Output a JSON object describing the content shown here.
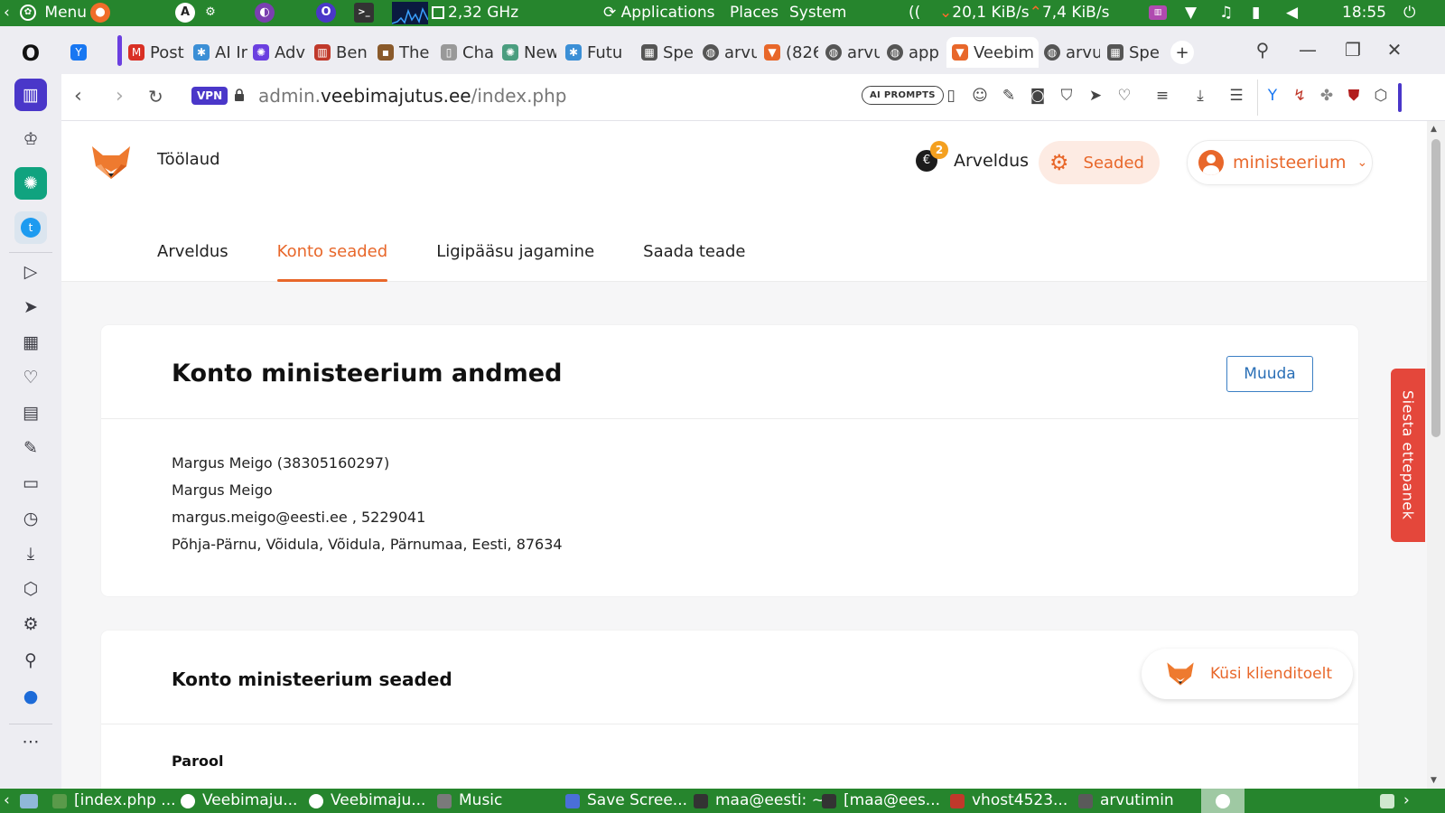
{
  "system_top": {
    "menu_label": "Menu",
    "cpu_freq": "2,32 GHz",
    "applications": "Applications",
    "places": "Places",
    "system": "System",
    "net_down": "20,1 KiB/s",
    "net_up": "7,4 KiB/s",
    "clock": "18:55"
  },
  "tabs": [
    {
      "label": "Post",
      "icon": "gmail-icon",
      "color": "#d93025"
    },
    {
      "label": "AI Ir",
      "icon": "ai-icon",
      "color": "#3b8fd6"
    },
    {
      "label": "Adv",
      "icon": "chatgpt-icon",
      "color": "#6b3fe0"
    },
    {
      "label": "Ben",
      "icon": "grid-icon",
      "color": "#c0392b"
    },
    {
      "label": "The",
      "icon": "photo-icon",
      "color": "#8a5a2b"
    },
    {
      "label": "Cha",
      "icon": "book-icon",
      "color": "#777777"
    },
    {
      "label": "New",
      "icon": "chatgpt-icon",
      "color": "#4a9d7f"
    },
    {
      "label": "Futu",
      "icon": "ai-icon",
      "color": "#3b8fd6"
    },
    {
      "label": "Spe",
      "icon": "grid-icon",
      "color": "#555555"
    },
    {
      "label": "arvu",
      "icon": "globe-icon",
      "color": "#555555"
    },
    {
      "label": "(826",
      "icon": "fox-icon",
      "color": "#e8672a"
    },
    {
      "label": "arvu",
      "icon": "globe-icon",
      "color": "#555555"
    },
    {
      "label": "app",
      "icon": "globe-icon",
      "color": "#555555"
    },
    {
      "label": "Veebim",
      "icon": "fox-icon",
      "color": "#e8672a"
    },
    {
      "label": "arvu",
      "icon": "globe-icon",
      "color": "#555555"
    },
    {
      "label": "Spe",
      "icon": "grid-icon",
      "color": "#555555"
    }
  ],
  "address": {
    "vpn": "VPN",
    "url_prefix": "admin.",
    "url_domain": "veebimajutus.ee",
    "url_path": "/index.php",
    "ai_prompts": "AI PROMPTS"
  },
  "header": {
    "title": "Töölaud",
    "billing_label": "Arveldus",
    "billing_badge": "2",
    "settings_label": "Seaded",
    "user_label": "ministeerium"
  },
  "subtabs": [
    {
      "label": "Arveldus",
      "active": false
    },
    {
      "label": "Konto seaded",
      "active": true
    },
    {
      "label": "Ligipääsu jagamine",
      "active": false
    },
    {
      "label": "Saada teade",
      "active": false
    }
  ],
  "account_card": {
    "title": "Konto ministeerium andmed",
    "edit_button": "Muuda",
    "lines": [
      "Margus Meigo (38305160297)",
      "Margus Meigo",
      "margus.meigo@eesti.ee , 5229041",
      "Põhja-Pärnu, Võidula, Võidula, Pärnumaa, Eesti, 87634"
    ]
  },
  "settings_card": {
    "title": "Konto ministeerium seaded",
    "password_label": "Parool"
  },
  "support_button": "Küsi klienditoelt",
  "feedback_tab": "Siesta ettepanek",
  "taskbar": [
    {
      "label": "[index.php ...",
      "color": "#5a9a4a"
    },
    {
      "label": "Veebimaju...",
      "color": "#222222"
    },
    {
      "label": "Veebimaju...",
      "color": "#222222"
    },
    {
      "label": "Music",
      "color": "#7a7a7a"
    },
    {
      "label": "Save Scree...",
      "color": "#4a6fd8"
    },
    {
      "label": "maa@eesti: ~",
      "color": "#333333"
    },
    {
      "label": "[maa@ees...",
      "color": "#333333"
    },
    {
      "label": "vhost4523...",
      "color": "#c0392b"
    },
    {
      "label": "arvutimin",
      "color": "#5a5a5a"
    }
  ],
  "colors": {
    "accent": "#e8672a",
    "panel": "#26852d",
    "link_blue": "#2a6fb6",
    "feedback_red": "#e4473b"
  }
}
